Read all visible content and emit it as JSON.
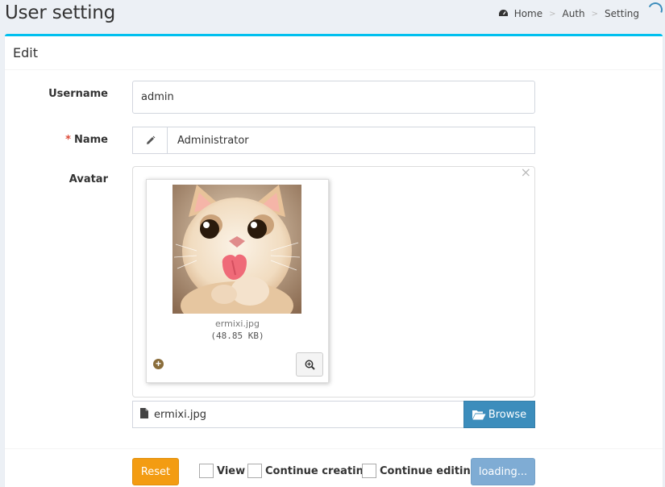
{
  "header": {
    "title": "User setting",
    "breadcrumb": [
      "Home",
      "Auth",
      "Setting"
    ]
  },
  "box": {
    "title": "Edit"
  },
  "form": {
    "username": {
      "label": "Username",
      "value": "admin"
    },
    "name": {
      "label": "Name",
      "required_marker": "*",
      "value": "Administrator",
      "addon_icon": "pencil-icon"
    },
    "avatar": {
      "label": "Avatar",
      "close_symbol": "×",
      "filename": "ermixi.jpg",
      "filesize": "(48.85 KB)",
      "file_field_value": "ermixi.jpg",
      "browse_label": "Browse"
    }
  },
  "footer": {
    "reset_label": "Reset",
    "checks": [
      "View",
      "Continue creating",
      "Continue editing"
    ],
    "submit_label": "loading..."
  },
  "colors": {
    "primary": "#3c8dbc",
    "accent_top_border": "#00c0ef",
    "warning": "#f39c12",
    "required": "#dd4b39"
  }
}
